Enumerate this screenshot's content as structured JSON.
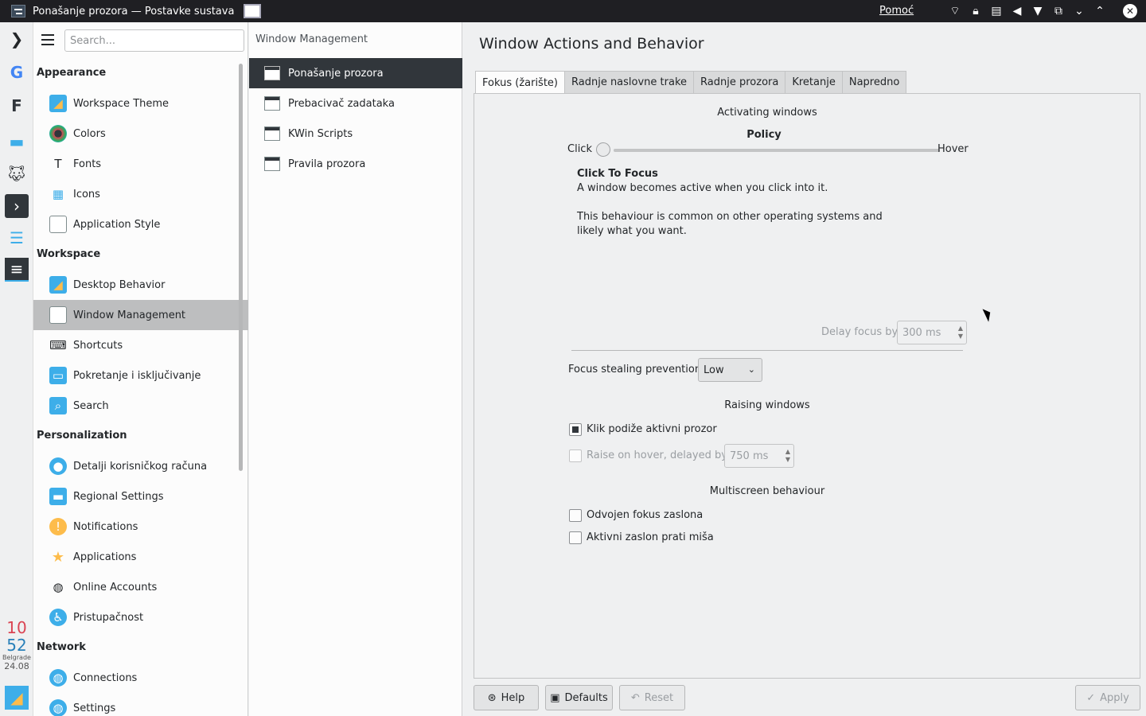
{
  "window": {
    "title": "Ponašanje prozora  — Postavke sustava",
    "help_menu": "Pomoć"
  },
  "dock": {
    "clock_hour": "10",
    "clock_minute": "52",
    "clock_city": "Belgrade",
    "clock_date": "24.08"
  },
  "sidebar": {
    "search_placeholder": "Search...",
    "categories": [
      {
        "title": "Appearance",
        "items": [
          "Workspace Theme",
          "Colors",
          "Fonts",
          "Icons",
          "Application Style"
        ]
      },
      {
        "title": "Workspace",
        "items": [
          "Desktop Behavior",
          "Window Management",
          "Shortcuts",
          "Pokretanje i isključivanje",
          "Search"
        ]
      },
      {
        "title": "Personalization",
        "items": [
          "Detalji korisničkog računa",
          "Regional Settings",
          "Notifications",
          "Applications",
          "Online Accounts",
          "Pristupačnost"
        ]
      },
      {
        "title": "Network",
        "items": [
          "Connections",
          "Settings"
        ]
      }
    ]
  },
  "modules": {
    "header": "Window Management",
    "items": [
      "Ponašanje prozora",
      "Prebacivač zadataka",
      "KWin Scripts",
      "Pravila prozora"
    ]
  },
  "content": {
    "title": "Window Actions and Behavior",
    "tabs": [
      "Fokus (žarište)",
      "Radnje naslovne trake",
      "Radnje prozora",
      "Kretanje",
      "Napredno"
    ],
    "activating_title": "Activating windows",
    "policy_label": "Policy",
    "slider_min": "Click",
    "slider_max": "Hover",
    "slider_value": 0,
    "policy_name": "Click To Focus",
    "policy_desc1": "A window becomes active when you click into it.",
    "policy_desc2": "This behaviour is common on other operating systems and",
    "policy_desc3": "likely what you want.",
    "delay_label": "Delay focus by",
    "delay_value": "300 ms",
    "stealing_label": "Focus stealing prevention",
    "stealing_value": "Low",
    "raising_title": "Raising windows",
    "click_raise_label": "Klik podiže aktivni prozor",
    "click_raise_checked": true,
    "hover_raise_label": "Raise on hover, delayed by",
    "hover_raise_checked": false,
    "hover_raise_value": "750 ms",
    "multiscreen_title": "Multiscreen behaviour",
    "separate_focus_label": "Odvojen fokus zaslona",
    "follow_mouse_label": "Aktivni zaslon prati miša"
  },
  "buttons": {
    "help": "Help",
    "defaults": "Defaults",
    "reset": "Reset",
    "apply": "Apply"
  }
}
